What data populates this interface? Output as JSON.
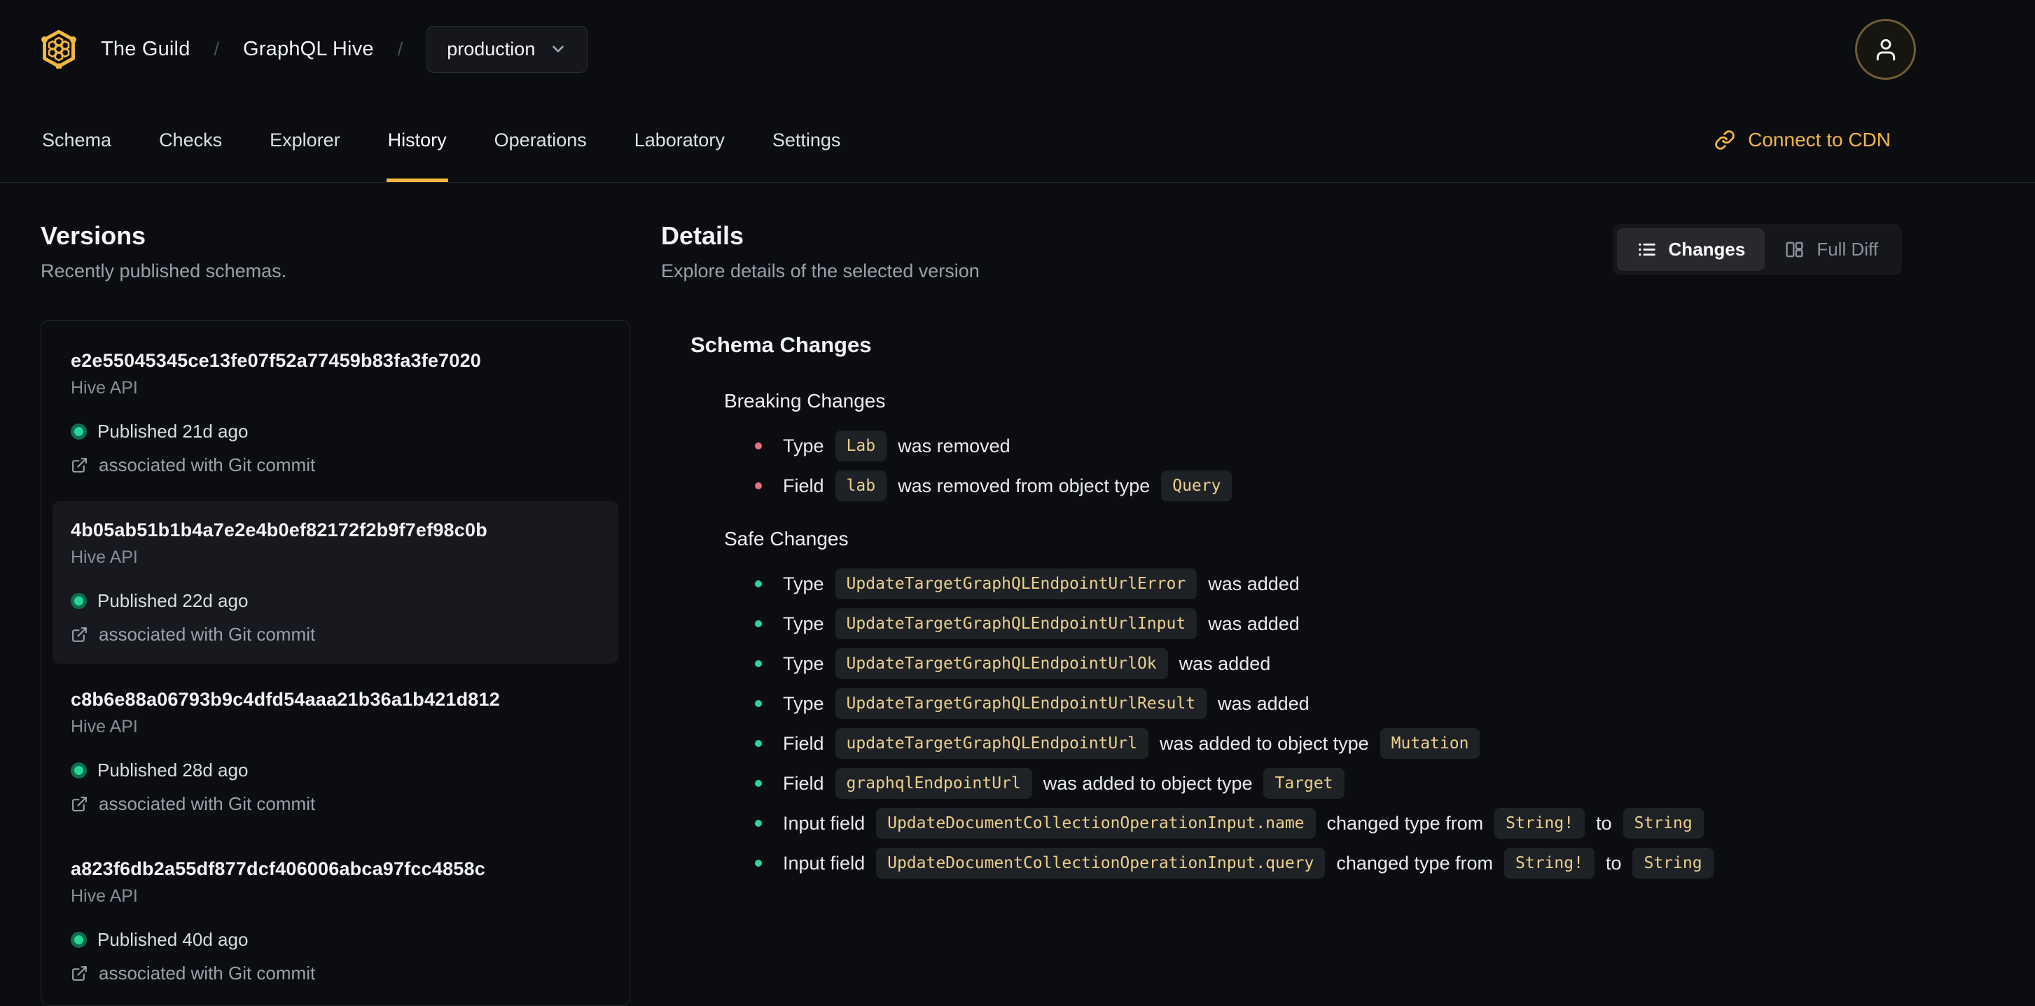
{
  "header": {
    "org": "The Guild",
    "project": "GraphQL Hive",
    "separator": "/",
    "target_selector": {
      "value": "production"
    }
  },
  "nav": {
    "tabs": [
      {
        "label": "Schema",
        "active": false
      },
      {
        "label": "Checks",
        "active": false
      },
      {
        "label": "Explorer",
        "active": false
      },
      {
        "label": "History",
        "active": true
      },
      {
        "label": "Operations",
        "active": false
      },
      {
        "label": "Laboratory",
        "active": false
      },
      {
        "label": "Settings",
        "active": false
      }
    ],
    "connect_cdn_label": "Connect to CDN"
  },
  "versions": {
    "title": "Versions",
    "subtitle": "Recently published schemas.",
    "items": [
      {
        "hash": "e2e55045345ce13fe07f52a77459b83fa3fe7020",
        "service": "Hive API",
        "published": "Published 21d ago",
        "git": "associated with Git commit",
        "selected": false
      },
      {
        "hash": "4b05ab51b1b4a7e2e4b0ef82172f2b9f7ef98c0b",
        "service": "Hive API",
        "published": "Published 22d ago",
        "git": "associated with Git commit",
        "selected": true
      },
      {
        "hash": "c8b6e88a06793b9c4dfd54aaa21b36a1b421d812",
        "service": "Hive API",
        "published": "Published 28d ago",
        "git": "associated with Git commit",
        "selected": false
      },
      {
        "hash": "a823f6db2a55df877dcf406006abca97fcc4858c",
        "service": "Hive API",
        "published": "Published 40d ago",
        "git": "associated with Git commit",
        "selected": false
      }
    ]
  },
  "details": {
    "title": "Details",
    "subtitle": "Explore details of the selected version",
    "view_toggle": {
      "changes_label": "Changes",
      "full_diff_label": "Full Diff",
      "active": "Changes"
    },
    "schema_changes": {
      "title": "Schema Changes",
      "breaking": {
        "title": "Breaking Changes",
        "items": [
          {
            "segments": [
              [
                "text",
                "Type"
              ],
              [
                "code",
                "Lab"
              ],
              [
                "text",
                "was removed"
              ]
            ]
          },
          {
            "segments": [
              [
                "text",
                "Field"
              ],
              [
                "code",
                "lab"
              ],
              [
                "text",
                "was removed from object type"
              ],
              [
                "code",
                "Query"
              ]
            ]
          }
        ]
      },
      "safe": {
        "title": "Safe Changes",
        "items": [
          {
            "segments": [
              [
                "text",
                "Type"
              ],
              [
                "code",
                "UpdateTargetGraphQLEndpointUrlError"
              ],
              [
                "text",
                "was added"
              ]
            ]
          },
          {
            "segments": [
              [
                "text",
                "Type"
              ],
              [
                "code",
                "UpdateTargetGraphQLEndpointUrlInput"
              ],
              [
                "text",
                "was added"
              ]
            ]
          },
          {
            "segments": [
              [
                "text",
                "Type"
              ],
              [
                "code",
                "UpdateTargetGraphQLEndpointUrlOk"
              ],
              [
                "text",
                "was added"
              ]
            ]
          },
          {
            "segments": [
              [
                "text",
                "Type"
              ],
              [
                "code",
                "UpdateTargetGraphQLEndpointUrlResult"
              ],
              [
                "text",
                "was added"
              ]
            ]
          },
          {
            "segments": [
              [
                "text",
                "Field"
              ],
              [
                "code",
                "updateTargetGraphQLEndpointUrl"
              ],
              [
                "text",
                "was added to object type"
              ],
              [
                "code",
                "Mutation"
              ]
            ]
          },
          {
            "segments": [
              [
                "text",
                "Field"
              ],
              [
                "code",
                "graphqlEndpointUrl"
              ],
              [
                "text",
                "was added to object type"
              ],
              [
                "code",
                "Target"
              ]
            ]
          },
          {
            "segments": [
              [
                "text",
                "Input field"
              ],
              [
                "code",
                "UpdateDocumentCollectionOperationInput.name"
              ],
              [
                "text",
                "changed type from"
              ],
              [
                "code",
                "String!"
              ],
              [
                "text",
                "to"
              ],
              [
                "code",
                "String"
              ]
            ]
          },
          {
            "segments": [
              [
                "text",
                "Input field"
              ],
              [
                "code",
                "UpdateDocumentCollectionOperationInput.query"
              ],
              [
                "text",
                "changed type from"
              ],
              [
                "code",
                "String!"
              ],
              [
                "text",
                "to"
              ],
              [
                "code",
                "String"
              ]
            ]
          }
        ]
      }
    }
  },
  "icons": {
    "brand": "hive-logo",
    "target_selector": "chevron-down-icon",
    "account": "user-icon",
    "connect_cdn": "link-icon",
    "changes_view": "list-icon",
    "full_diff_view": "columns-icon",
    "git_association": "external-link-icon",
    "published_status": "status-dot"
  },
  "colors": {
    "bg": "#0b0d11",
    "accent": "#f4b740",
    "badge-text": "#ecd089",
    "bullet-breaking": "#e8707a",
    "bullet-safe": "#2dd4a0",
    "dot-core": "#2bd598",
    "dot-ring": "#0d6e50"
  }
}
